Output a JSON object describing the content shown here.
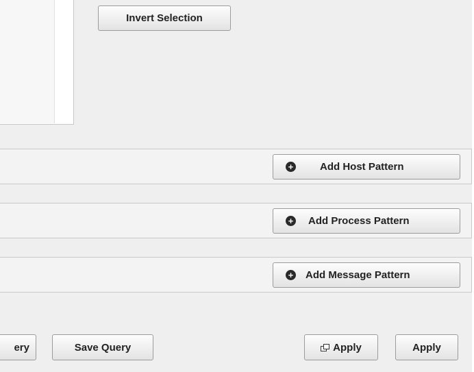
{
  "selection": {
    "invert_label": "Invert Selection"
  },
  "patterns": {
    "host": {
      "add_label": "Add Host Pattern",
      "icon": "plus-circle-icon"
    },
    "process": {
      "add_label": "Add Process Pattern",
      "icon": "plus-circle-icon"
    },
    "message": {
      "add_label": "Add Message Pattern",
      "icon": "plus-circle-icon"
    }
  },
  "footer": {
    "query_partial_label": "ery",
    "save_query_label": "Save Query",
    "apply_external_label": "Apply",
    "apply_external_icon": "external-window-icon",
    "apply_label": "Apply"
  }
}
